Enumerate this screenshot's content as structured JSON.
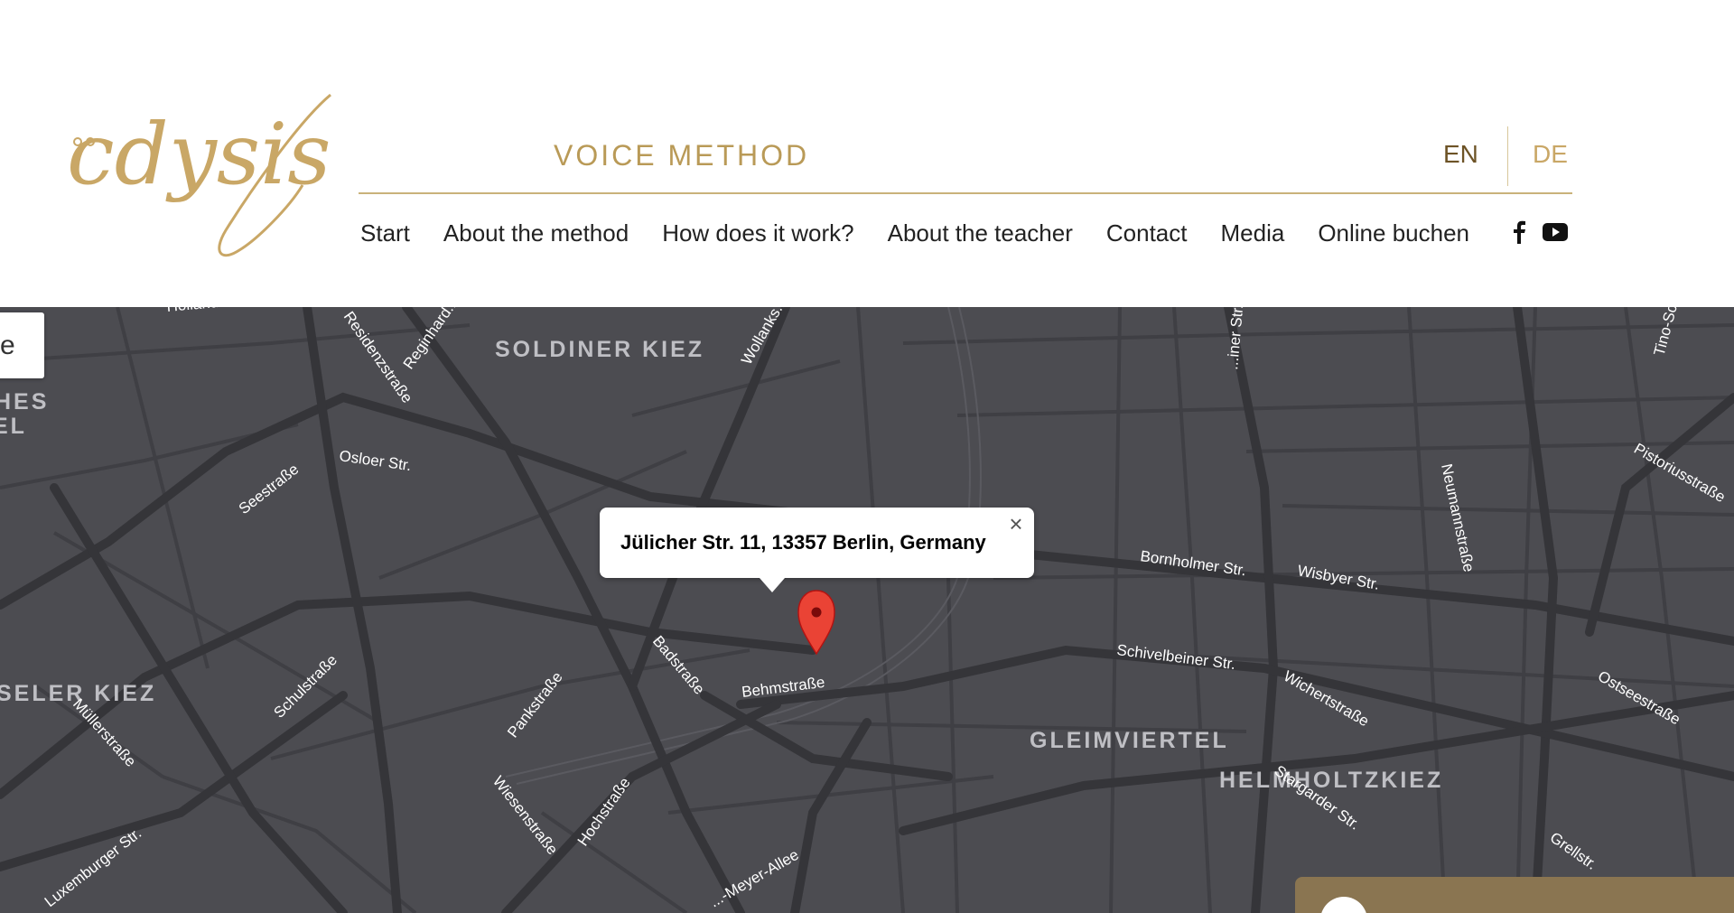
{
  "brand": {
    "logo_text": "cdysis",
    "tagline": "VOICE METHOD",
    "color": "#c9a766"
  },
  "languages": {
    "en": "EN",
    "de": "DE",
    "active": "EN"
  },
  "nav": {
    "items": [
      {
        "label": "Start"
      },
      {
        "label": "About the method"
      },
      {
        "label": "How does it work?"
      },
      {
        "label": "About the teacher"
      },
      {
        "label": "Contact"
      },
      {
        "label": "Media"
      },
      {
        "label": "Online buchen"
      }
    ],
    "social": [
      {
        "icon": "facebook-icon"
      },
      {
        "icon": "youtube-icon"
      }
    ]
  },
  "map": {
    "info_window": {
      "address": "Jülicher Str. 11, 13357 Berlin, Germany",
      "close_glyph": "×"
    },
    "control_text": "e",
    "districts": [
      "SOLDINER KIEZ",
      "GLEIMVIERTEL",
      "SELER KIEZ",
      "HELMHOLTZKIEZ",
      "HES",
      "EL"
    ],
    "streets": [
      "Hollander...",
      "Residenzstraße",
      "Reginhard...",
      "Wollanks...",
      "Osloer Str.",
      "Seestraße",
      "Bornholmer Str.",
      "Wisbyer Str.",
      "Schivelbeiner Str.",
      "Behmstraße",
      "Badstraße",
      "Pankstraße",
      "Schulstraße",
      "Müllerstraße",
      "Wiesenstraße",
      "Hochstraße",
      "Wichertstraße",
      "Stargarder Str.",
      "Ostseestraße",
      "Pistoriusstraße",
      "Neumannstraße",
      "Grellstr.",
      "Tino-Sc...",
      "Luxemburger Str.",
      "...-Meyer-Allee",
      "...iner Str."
    ],
    "marker_color": "#ea4335"
  }
}
